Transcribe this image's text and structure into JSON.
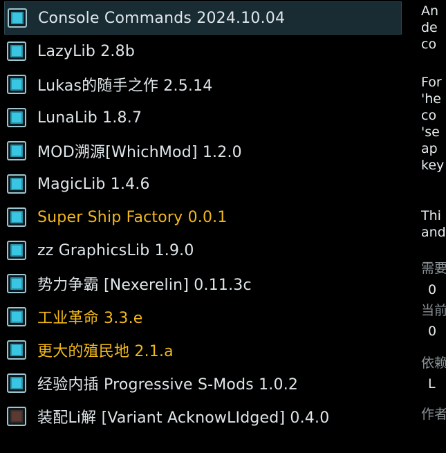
{
  "mod_list": [
    {
      "label": "Console Commands 2024.10.04",
      "enabled": true,
      "selected": true,
      "highlight": false
    },
    {
      "label": "LazyLib 2.8b",
      "enabled": true,
      "selected": false,
      "highlight": false
    },
    {
      "label": "Lukas的随手之作 2.5.14",
      "enabled": true,
      "selected": false,
      "highlight": false
    },
    {
      "label": "LunaLib 1.8.7",
      "enabled": true,
      "selected": false,
      "highlight": false
    },
    {
      "label": "MOD溯源[WhichMod] 1.2.0",
      "enabled": true,
      "selected": false,
      "highlight": false
    },
    {
      "label": "MagicLib 1.4.6",
      "enabled": true,
      "selected": false,
      "highlight": false
    },
    {
      "label": "Super Ship Factory 0.0.1",
      "enabled": true,
      "selected": false,
      "highlight": true
    },
    {
      "label": "zz GraphicsLib 1.9.0",
      "enabled": true,
      "selected": false,
      "highlight": false
    },
    {
      "label": "势力争霸 [Nexerelin] 0.11.3c",
      "enabled": true,
      "selected": false,
      "highlight": false
    },
    {
      "label": "工业革命 3.3.e",
      "enabled": true,
      "selected": false,
      "highlight": true
    },
    {
      "label": "更大的殖民地 2.1.a",
      "enabled": true,
      "selected": false,
      "highlight": true
    },
    {
      "label": "经验内插 Progressive S-Mods 1.0.2",
      "enabled": true,
      "selected": false,
      "highlight": false
    },
    {
      "label": "装配Li解 [Variant AcknowLIdged] 0.4.0",
      "enabled": false,
      "selected": false,
      "highlight": false
    }
  ],
  "details": {
    "description_1": [
      "An",
      "de",
      "co"
    ],
    "description_2": [
      "For",
      "'he",
      "co",
      "'se",
      "ap",
      "key"
    ],
    "description_3": [
      "Thi",
      "and"
    ],
    "required_label": "需要",
    "required_value": "0",
    "current_label": "当前",
    "current_value": "0",
    "dependency_label": "依赖",
    "dependency_value": "L",
    "author_label": "作者"
  },
  "colors": {
    "background": "#000000",
    "text": "#dfe6ea",
    "highlight_text": "#f2b81a",
    "selected_row": "#1a2c33",
    "checkbox_on": "#39c6e2",
    "checkbox_off": "#5a3a33",
    "dim_text": "#8b9397"
  }
}
